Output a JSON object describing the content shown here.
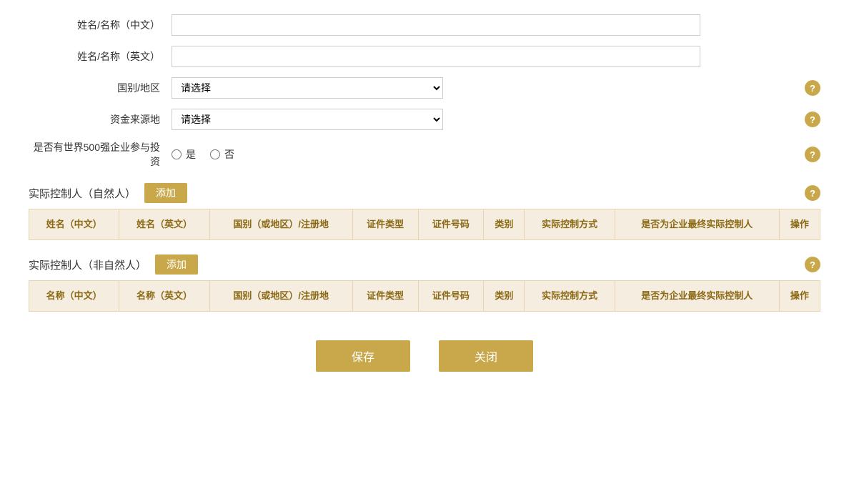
{
  "form": {
    "name_cn_label": "姓名/名称（中文）",
    "name_en_label": "姓名/名称（英文）",
    "country_label": "国别/地区",
    "fund_source_label": "资金来源地",
    "fortune500_label": "是否有世界500强企业参与投资",
    "country_placeholder": "请选择",
    "fund_source_placeholder": "请选择",
    "radio_yes": "是",
    "radio_no": "否",
    "name_cn_value": "",
    "name_en_value": ""
  },
  "section_natural": {
    "title": "实际控制人（自然人）",
    "add_label": "添加",
    "columns": [
      "姓名（中文）",
      "姓名（英文）",
      "国别（或地区）/注册地",
      "证件类型",
      "证件号码",
      "类别",
      "实际控制方式",
      "是否为企业最终实际控制人",
      "操作"
    ]
  },
  "section_non_natural": {
    "title": "实际控制人（非自然人）",
    "add_label": "添加",
    "columns": [
      "名称（中文）",
      "名称（英文）",
      "国别（或地区）/注册地",
      "证件类型",
      "证件号码",
      "类别",
      "实际控制方式",
      "是否为企业最终实际控制人",
      "操作"
    ]
  },
  "buttons": {
    "save": "保存",
    "close": "关闭"
  },
  "help_icon": "?"
}
